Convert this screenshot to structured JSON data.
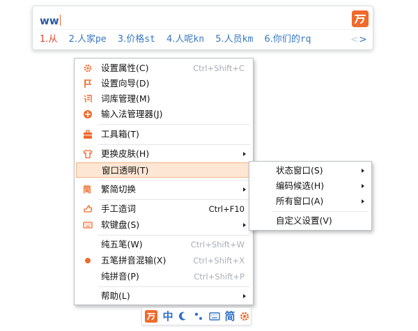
{
  "ime": {
    "input": "ww",
    "candidates": [
      {
        "num": "1.",
        "word": "从",
        "code": ""
      },
      {
        "num": "2.",
        "word": "人家",
        "code": "pe"
      },
      {
        "num": "3.",
        "word": "价格",
        "code": "st"
      },
      {
        "num": "4.",
        "word": "人呢",
        "code": "kn"
      },
      {
        "num": "5.",
        "word": "人员",
        "code": "km"
      },
      {
        "num": "6.",
        "word": "你们的",
        "code": "rq"
      }
    ],
    "pager": {
      "prev": "<",
      "next": ">"
    }
  },
  "menu": {
    "items": [
      {
        "icon": "gear-icon",
        "label": "设置属性(C)",
        "shortcut": "Ctrl+Shift+C"
      },
      {
        "icon": "flag-icon",
        "label": "设置向导(D)",
        "shortcut": ""
      },
      {
        "icon": "dictionary-icon",
        "label": "词库管理(M)",
        "shortcut": ""
      },
      {
        "icon": "ime-manager-icon",
        "label": "输入法管理器(J)",
        "shortcut": ""
      },
      {
        "icon": "toolbox-icon",
        "label": "工具箱(T)",
        "shortcut": ""
      },
      {
        "icon": "shirt-icon",
        "label": "更换皮肤(H)",
        "shortcut": ""
      },
      {
        "icon": "",
        "label": "窗口透明(T)",
        "shortcut": ""
      },
      {
        "icon": "jian-icon",
        "label": "繁简切换",
        "shortcut": ""
      },
      {
        "icon": "hand-icon",
        "label": "手工造词",
        "shortcut": "Ctrl+F10"
      },
      {
        "icon": "keyboard-icon",
        "label": "软键盘(S)",
        "shortcut": ""
      },
      {
        "icon": "",
        "label": "纯五笔(W)",
        "shortcut": "Ctrl+Shift+W"
      },
      {
        "icon": "dot-icon",
        "label": "五笔拼音混输(X)",
        "shortcut": "Ctrl+Shift+X"
      },
      {
        "icon": "",
        "label": "纯拼音(P)",
        "shortcut": "Ctrl+Shift+P"
      },
      {
        "icon": "",
        "label": "帮助(L)",
        "shortcut": ""
      }
    ]
  },
  "submenu": {
    "items": [
      {
        "label": "状态窗口(S)"
      },
      {
        "label": "编码候选(H)"
      },
      {
        "label": "所有窗口(A)"
      },
      {
        "label": "自定义设置(V)"
      }
    ]
  },
  "status": {
    "mode": "中",
    "charset": "简"
  },
  "colors": {
    "accent": "#ef6a2b",
    "candidate": "#3577c4",
    "selected_candidate": "#e0442b",
    "highlight_bg": "#fde6d4"
  }
}
